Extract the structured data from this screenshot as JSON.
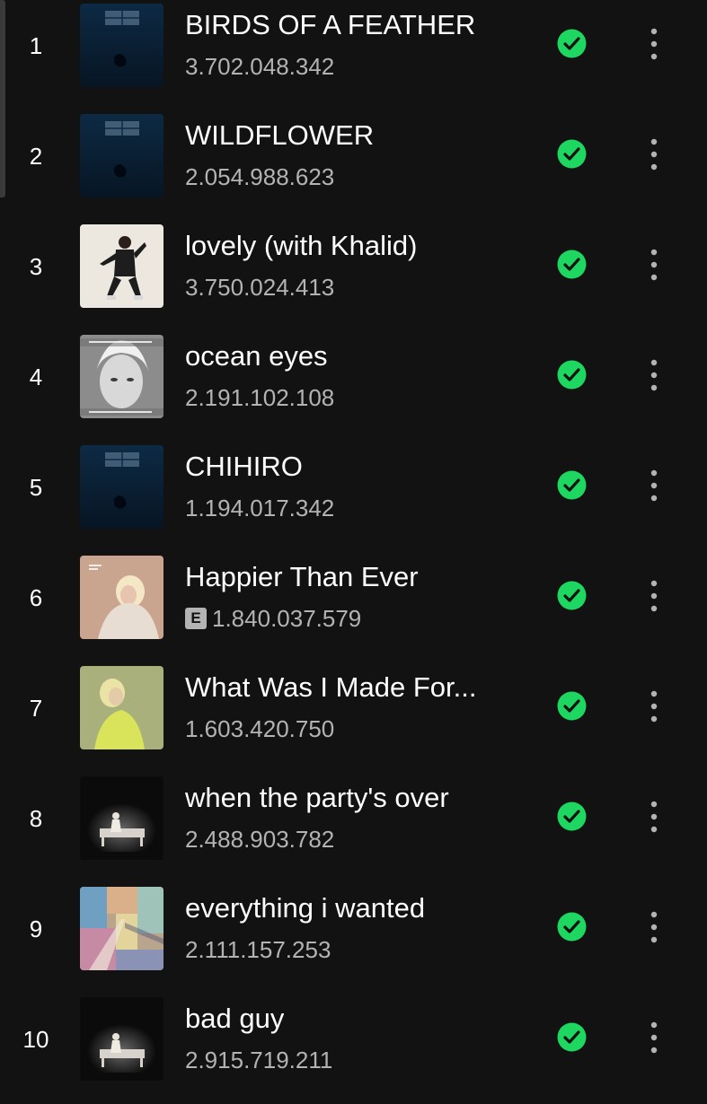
{
  "colors": {
    "background": "#121212",
    "accent_green": "#1ed760",
    "primary_text": "#ffffff",
    "secondary_text": "#b3b3b3"
  },
  "icons": {
    "downloaded": "check-circle-icon",
    "more": "more-vertical-icon",
    "explicit": "explicit-badge"
  },
  "tracks": [
    {
      "number": "1",
      "title": "BIRDS OF A FEATHER",
      "plays": "3.702.048.342",
      "explicit": false,
      "cover": "hit-me-hard-and-soft"
    },
    {
      "number": "2",
      "title": "WILDFLOWER",
      "plays": "2.054.988.623",
      "explicit": false,
      "cover": "hit-me-hard-and-soft"
    },
    {
      "number": "3",
      "title": "lovely (with Khalid)",
      "plays": "3.750.024.413",
      "explicit": false,
      "cover": "lovely"
    },
    {
      "number": "4",
      "title": "ocean eyes",
      "plays": "2.191.102.108",
      "explicit": false,
      "cover": "ocean-eyes"
    },
    {
      "number": "5",
      "title": "CHIHIRO",
      "plays": "1.194.017.342",
      "explicit": false,
      "cover": "hit-me-hard-and-soft"
    },
    {
      "number": "6",
      "title": "Happier Than Ever",
      "plays": "1.840.037.579",
      "explicit": true,
      "explicit_label": "E",
      "cover": "happier-than-ever"
    },
    {
      "number": "7",
      "title": "What Was I Made For...",
      "plays": "1.603.420.750",
      "explicit": false,
      "cover": "barbie"
    },
    {
      "number": "8",
      "title": "when the party's over",
      "plays": "2.488.903.782",
      "explicit": false,
      "cover": "when-we-all-fall-asleep"
    },
    {
      "number": "9",
      "title": "everything i wanted",
      "plays": "2.111.157.253",
      "explicit": false,
      "cover": "everything-i-wanted"
    },
    {
      "number": "10",
      "title": "bad guy",
      "plays": "2.915.719.211",
      "explicit": false,
      "cover": "when-we-all-fall-asleep"
    }
  ]
}
